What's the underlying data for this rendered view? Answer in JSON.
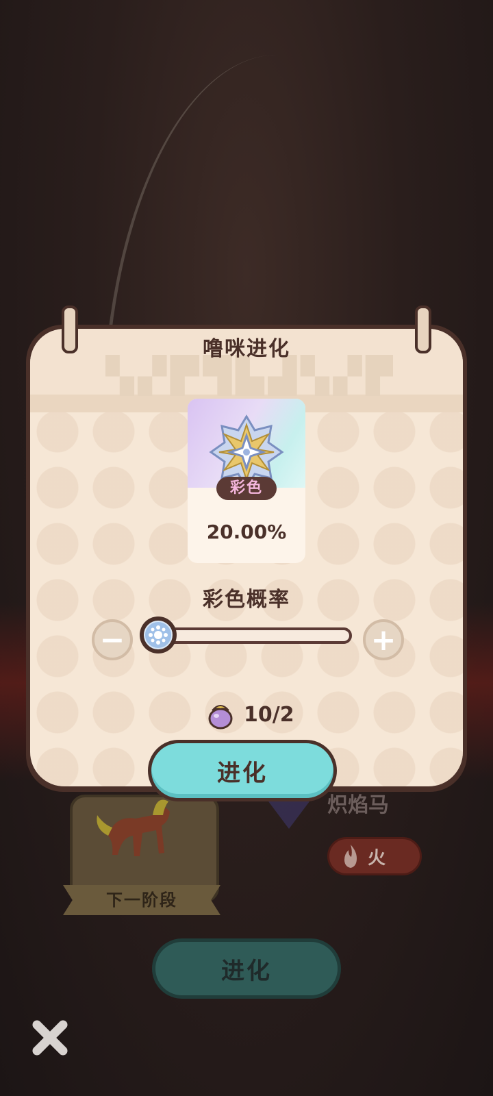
{
  "modal": {
    "title": "噜咪进化",
    "reward": {
      "rarity_label": "彩色",
      "probability": "20.00%",
      "emblem_icon": "rainbow-star-emblem"
    },
    "slider": {
      "label": "彩色概率",
      "value_fraction": 0.08,
      "minus_icon": "minus-icon",
      "plus_icon": "plus-icon"
    },
    "cost": {
      "item_icon": "purple-fruit-icon",
      "amount": "10/2"
    },
    "evolve_button": "进化"
  },
  "background": {
    "next_stage_label": "下一阶段",
    "pet_name_partial": "炽焰马",
    "type_label": "火",
    "evolve_button": "进化",
    "close_icon": "close-icon"
  },
  "colors": {
    "accent": "#7ddcdc",
    "panel": "#f6e7d6",
    "outline": "#4a3029",
    "fire": "#6a2a22"
  }
}
